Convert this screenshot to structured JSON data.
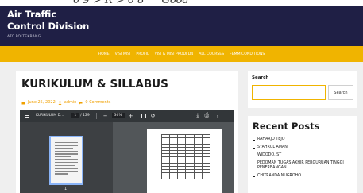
{
  "top_scrap": {
    "expr": "0 9 > R > 0 8",
    "note": "Good"
  },
  "site": {
    "title_line1": "Air Traffic",
    "title_line2": "Control Division",
    "tagline": "ATC POLTEKBANG"
  },
  "nav": {
    "items": [
      "HOME",
      "VISI MISI",
      "PROFIL",
      "VISI & MISI PRODI D4",
      "ALL COURSES",
      "FEMM CONDITIONS"
    ]
  },
  "article": {
    "title": "KURIKULUM & SILLABUS",
    "date": "June 25, 2022",
    "author": "admin",
    "comments": "0 Comments"
  },
  "pdf_viewer": {
    "filename": "KURIKULUM D...",
    "page_current": "1",
    "page_total": "/ 129",
    "zoom": "36%",
    "thumb_page_number": "1"
  },
  "search": {
    "label": "Search",
    "button_label": "Search",
    "placeholder": ""
  },
  "recent_posts": {
    "title": "Recent Posts",
    "items": [
      "RAHARJO TEJO",
      "SYAHRUL AMAN",
      "WIDODO, ST",
      "PEDOMAN TUGAS AKHIR PERGURUAN TINGGI PENERBANGAN",
      "CHITRANDA NUGROHO"
    ]
  },
  "colors": {
    "header_bg": "#1f1f45",
    "nav_bg": "#f0b400",
    "accent": "#f0a000",
    "viewer_bg": "#525659"
  }
}
